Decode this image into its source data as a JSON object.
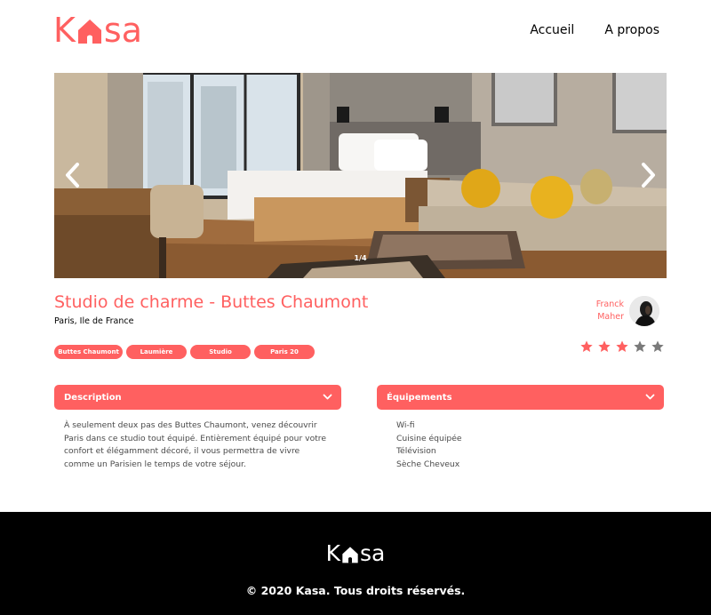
{
  "brand": {
    "logo_left": "K",
    "logo_right": "sa",
    "accent_color": "#FF6060"
  },
  "nav": {
    "home": "Accueil",
    "about": "A propos"
  },
  "carousel": {
    "counter": "1/4",
    "prev_icon": "chevron-left-icon",
    "next_icon": "chevron-right-icon"
  },
  "listing": {
    "title": "Studio de charme - Buttes Chaumont",
    "location": "Paris, Ile de France",
    "host": {
      "first_name": "Franck",
      "last_name": "Maher"
    },
    "tags": [
      "Buttes Chaumont",
      "Laumière",
      "Studio",
      "Paris 20"
    ],
    "rating": 3,
    "rating_max": 5
  },
  "description": {
    "title": "Description",
    "text": "À seulement deux pas des Buttes Chaumont, venez découvrir Paris dans ce studio tout équipé. Entièrement équipé pour votre confort et élégamment décoré, il vous permettra de vivre comme un Parisien le temps de votre séjour."
  },
  "equipments": {
    "title": "Équipements",
    "items": [
      "Wi-fi",
      "Cuisine équipée",
      "Télévision",
      "Sèche Cheveux"
    ]
  },
  "footer": {
    "copyright": "© 2020 Kasa. Tous droits réservés."
  }
}
